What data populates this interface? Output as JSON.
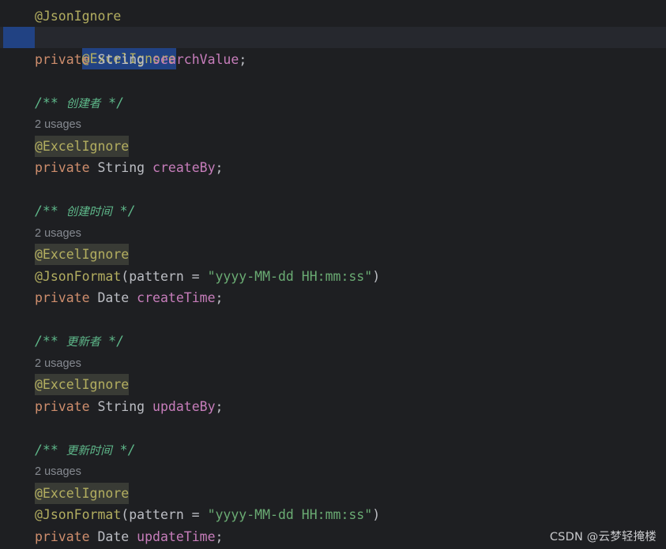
{
  "code": {
    "line1": {
      "text": "@JsonIgnore"
    },
    "line2": {
      "text": "@ExcelIgnore"
    },
    "line3": {
      "kw": "private",
      "type": "String",
      "field": "searchValue",
      "end": ";"
    },
    "line5": {
      "open": "/** ",
      "cn": "创建者",
      "close": " */"
    },
    "line6": {
      "hint": "2 usages"
    },
    "line7": {
      "text": "@ExcelIgnore"
    },
    "line8": {
      "kw": "private",
      "type": "String",
      "field": "createBy",
      "end": ";"
    },
    "line10": {
      "open": "/** ",
      "cn": "创建时间",
      "close": " */"
    },
    "line11": {
      "hint": "2 usages"
    },
    "line12": {
      "text": "@ExcelIgnore"
    },
    "line13": {
      "anno": "@JsonFormat",
      "args_open": "(pattern = ",
      "str": "\"yyyy-MM-dd HH:mm:ss\"",
      "args_close": ")"
    },
    "line14": {
      "kw": "private",
      "type": "Date",
      "field": "createTime",
      "end": ";"
    },
    "line16": {
      "open": "/** ",
      "cn": "更新者",
      "close": " */"
    },
    "line17": {
      "hint": "2 usages"
    },
    "line18": {
      "text": "@ExcelIgnore"
    },
    "line19": {
      "kw": "private",
      "type": "String",
      "field": "updateBy",
      "end": ";"
    },
    "line21": {
      "open": "/** ",
      "cn": "更新时间",
      "close": " */"
    },
    "line22": {
      "hint": "2 usages"
    },
    "line23": {
      "text": "@ExcelIgnore"
    },
    "line24": {
      "anno": "@JsonFormat",
      "args_open": "(pattern = ",
      "str": "\"yyyy-MM-dd HH:mm:ss\"",
      "args_close": ")"
    },
    "line25": {
      "kw": "private",
      "type": "Date",
      "field": "updateTime",
      "end": ";"
    }
  },
  "watermark": "CSDN @云梦轻掩楼",
  "colors": {
    "background": "#1e1f22",
    "keyword": "#cf8e6d",
    "field": "#c77dbb",
    "annotation": "#b3ae60",
    "string": "#6aab73",
    "doc_comment": "#5fb98b",
    "selection": "#214283"
  }
}
